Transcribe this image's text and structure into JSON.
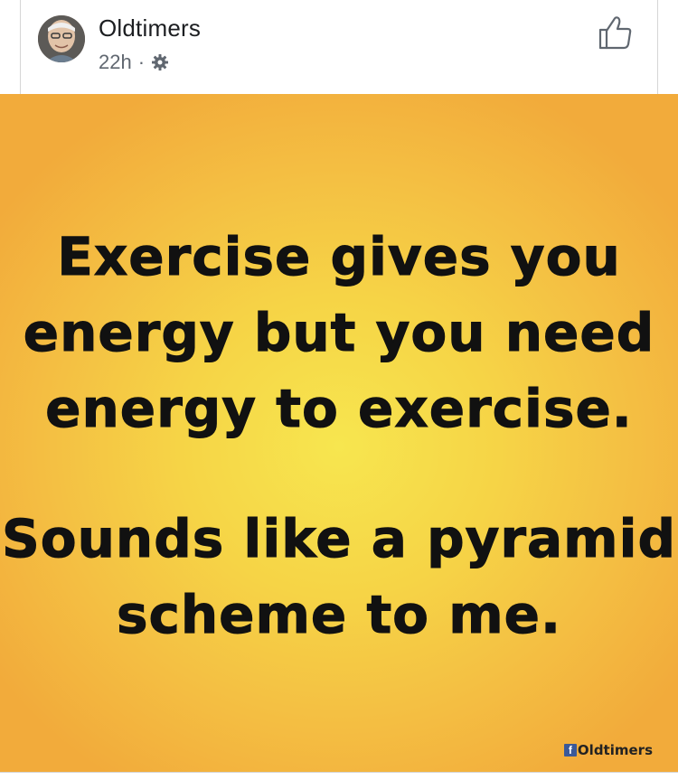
{
  "post": {
    "page_name": "Oldtimers",
    "timestamp": "22h",
    "separator": "·",
    "privacy_icon": "gear-icon",
    "like_icon": "thumbs-up-icon"
  },
  "image": {
    "quote_block_1": [
      "Exercise gives you",
      "energy but you need",
      "energy to exercise."
    ],
    "quote_block_2": [
      "Sounds like a pyramid",
      "scheme to me."
    ],
    "watermark_badge": "f",
    "watermark_text": "Oldtimers"
  },
  "colors": {
    "background_center": "#f7e64f",
    "background_edge": "#f2ab3b",
    "text": "#111111",
    "facebook_blue": "#3b5998"
  }
}
